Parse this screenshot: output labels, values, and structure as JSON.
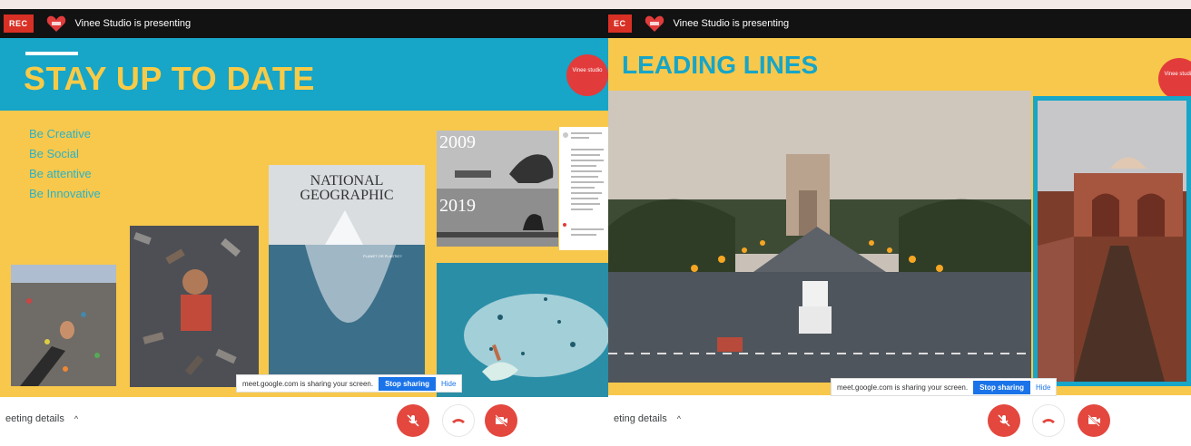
{
  "left": {
    "rec": "REC",
    "presenting": "Vinee Studio is presenting",
    "slide": {
      "title": "STAY UP TO DATE",
      "logo_text": "Vinee studio",
      "bullets": [
        "Be Creative",
        "Be Social",
        "Be attentive",
        "Be Innovative"
      ],
      "nat_geo_line1": "NATIONAL",
      "nat_geo_line2": "GEOGRAPHIC",
      "nat_geo_caption": "PLANET OR PLASTIC?",
      "year_top": "2009",
      "year_bottom": "2019"
    },
    "share_bar": {
      "message": "meet.google.com is sharing your screen.",
      "stop": "Stop sharing",
      "hide": "Hide"
    },
    "meeting_details": "eeting details"
  },
  "right": {
    "rec": "EC",
    "presenting": "Vinee Studio is presenting",
    "slide": {
      "title": "LEADING LINES",
      "logo_text": "Vinee studio"
    },
    "share_bar": {
      "message": "meet.google.com is sharing your screen.",
      "stop": "Stop sharing",
      "hide": "Hide"
    },
    "meeting_details": "eting details"
  },
  "colors": {
    "slide_yellow": "#f7c84b",
    "slide_blue": "#17a5c8",
    "control_red": "#e3473e",
    "rec_red": "#d93025",
    "share_blue": "#1a73e8"
  },
  "icons": [
    "heart-logo-icon",
    "mic-off-icon",
    "end-call-icon",
    "camera-off-icon",
    "chevron-up-icon"
  ]
}
